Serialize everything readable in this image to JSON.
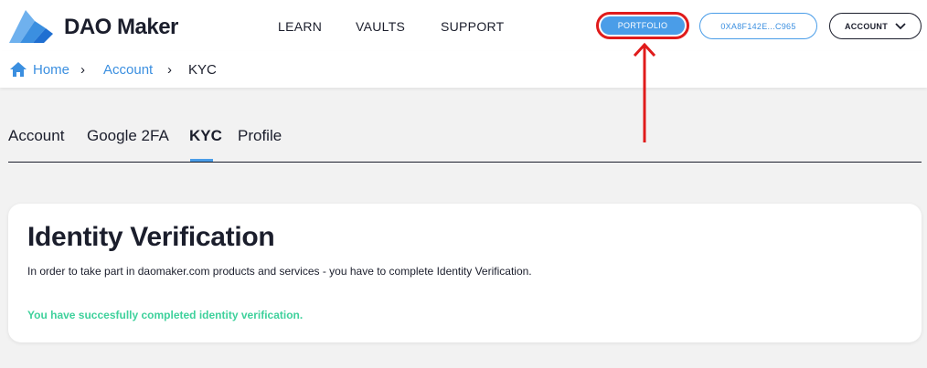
{
  "header": {
    "brand": "DAO Maker",
    "nav": [
      "LEARN",
      "VAULTS",
      "SUPPORT"
    ],
    "portfolio_label": "PORTFOLIO",
    "wallet_label": "0XA8F142E...C965",
    "account_label": "ACCOUNT",
    "logo_icon": "dao-maker-logo",
    "highlight_color": "#e01b1b",
    "accent_color": "#4a9de8"
  },
  "breadcrumb": {
    "home": "Home",
    "separator": "›",
    "account": "Account",
    "current": "KYC"
  },
  "tabs": [
    "Account",
    "Google 2FA",
    "KYC",
    "Profile"
  ],
  "active_tab": "KYC",
  "card": {
    "title": "Identity Verification",
    "description": "In order to take part in daomaker.com products and services - you have to complete Identity Verification.",
    "status": "You have succesfully completed identity verification.",
    "status_color": "#3fd19c"
  }
}
